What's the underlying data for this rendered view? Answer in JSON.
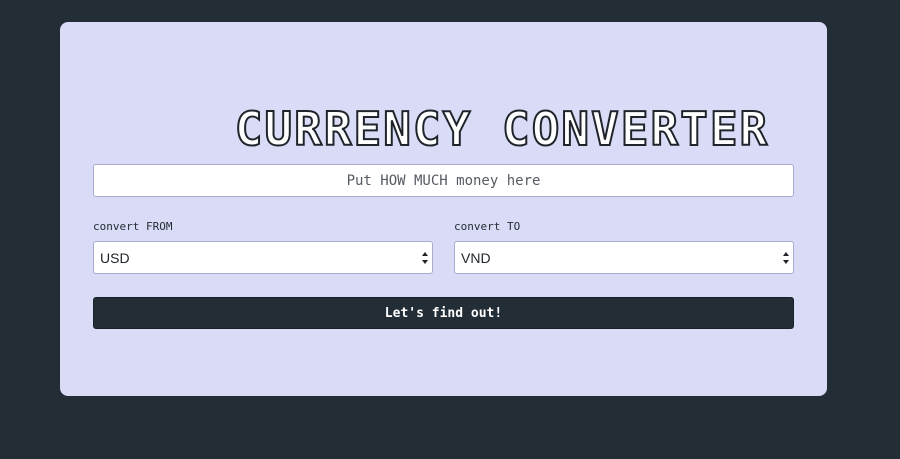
{
  "app": {
    "title": "CURRENCY CONVERTER"
  },
  "amount": {
    "placeholder": "Put HOW MUCH money here",
    "value": ""
  },
  "from": {
    "label": "convert FROM",
    "selected": "USD"
  },
  "to": {
    "label": "convert TO",
    "selected": "VND"
  },
  "submit": {
    "label": "Let's find out!"
  },
  "colors": {
    "background": "#232d35",
    "card": "#d9dbf7",
    "button": "#232d35",
    "button_text": "#ffffff"
  },
  "icons": {
    "select_arrows": "chevron-up-down-icon"
  }
}
